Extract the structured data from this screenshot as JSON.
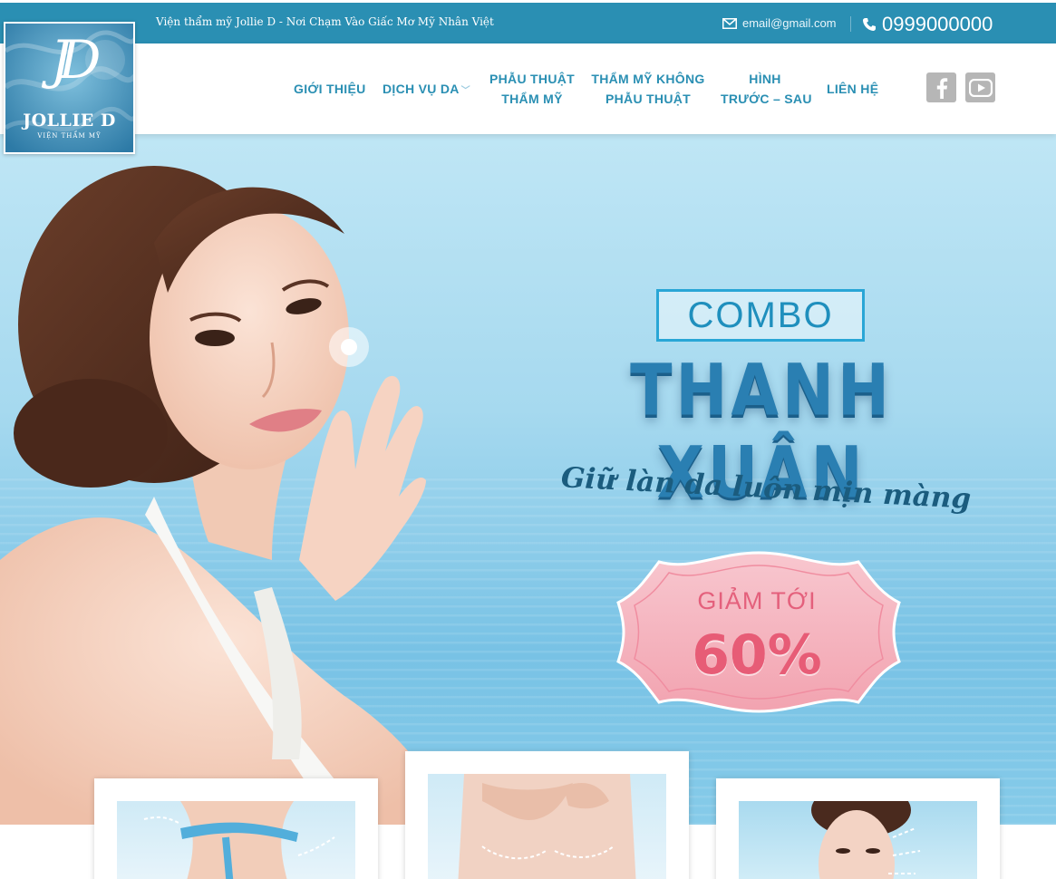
{
  "topbar": {
    "tagline": "Viện thẩm mỹ Jollie D - Nơi Chạm Vào Giấc Mơ Mỹ Nhân Việt",
    "email": "email@gmail.com",
    "phone": "0999000000",
    "background": "#2a8fb3"
  },
  "logo": {
    "name": "JOLLIE D",
    "sub": "VIỆN THẨM MỸ",
    "monogram": "JD"
  },
  "nav": {
    "items": [
      {
        "line1": "GIỚI THIỆU",
        "line2": ""
      },
      {
        "line1": "DỊCH VỤ DA",
        "line2": ""
      },
      {
        "line1": "PHẪU THUẬT",
        "line2": "THẨM MỸ"
      },
      {
        "line1": "THẨM MỸ KHÔNG",
        "line2": "PHẪU THUẬT"
      },
      {
        "line1": "HÌNH",
        "line2": "TRƯỚC – SAU"
      },
      {
        "line1": "LIÊN HỆ",
        "line2": ""
      }
    ],
    "dropdown_icon": "chevron-down-icon",
    "color": "#2a8fb3"
  },
  "social": {
    "icons": [
      "facebook-icon",
      "youtube-icon"
    ],
    "color": "#b6b6b6"
  },
  "hero": {
    "combo": "COMBO",
    "title": "THANH XUÂN",
    "subtitle": "Giữ làn da luôn mịn màng",
    "badge_line1": "GIẢM TỚI",
    "badge_line2": "60%",
    "accent_color": "#29a6d6",
    "badge_color": "#f4b4be"
  },
  "cards": [
    {
      "image": "body-measurement-image"
    },
    {
      "image": "breast-surgery-image"
    },
    {
      "image": "face-lift-image"
    }
  ]
}
